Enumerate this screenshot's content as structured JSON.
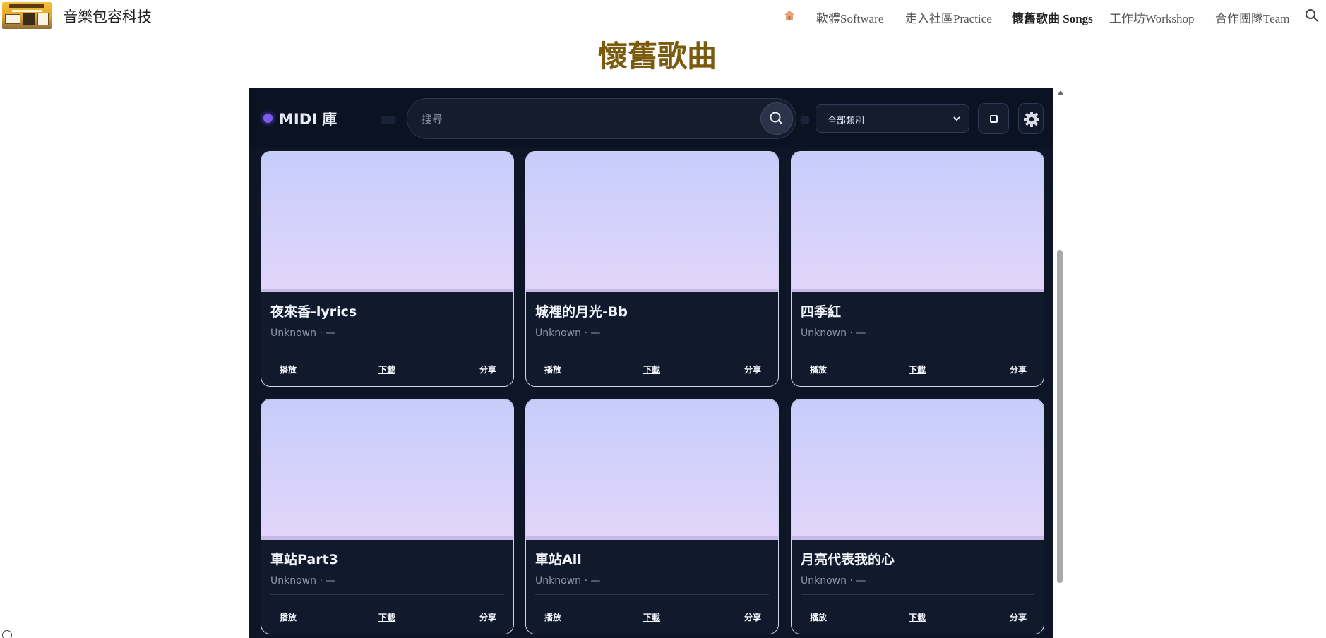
{
  "site": {
    "title": "音樂包容科技",
    "nav": [
      "軟體Software",
      "走入社區Practice",
      "懷舊歌曲 Songs",
      "工作坊Workshop",
      "合作團隊Team"
    ],
    "active_nav": "懷舊歌曲 Songs"
  },
  "page": {
    "title": "懷舊歌曲"
  },
  "app": {
    "brand": "MIDI 庫",
    "search": {
      "placeholder": "搜尋",
      "value": ""
    },
    "category_select": {
      "selected": "全部類別"
    },
    "accent_color": "#7c5cf0"
  },
  "songs": [
    {
      "title": "夜來香-lyrics",
      "meta": "Unknown · —",
      "play": "播放",
      "download": "下載",
      "share": "分享"
    },
    {
      "title": "城裡的月光-Bb",
      "meta": "Unknown · —",
      "play": "播放",
      "download": "下載",
      "share": "分享"
    },
    {
      "title": "四季紅",
      "meta": "Unknown · —",
      "play": "播放",
      "download": "下載",
      "share": "分享"
    },
    {
      "title": "車站Part3",
      "meta": "Unknown · —",
      "play": "播放",
      "download": "下載",
      "share": "分享"
    },
    {
      "title": "車站All",
      "meta": "Unknown · —",
      "play": "播放",
      "download": "下載",
      "share": "分享"
    },
    {
      "title": "月亮代表我的心",
      "meta": "Unknown · —",
      "play": "播放",
      "download": "下載",
      "share": "分享"
    }
  ],
  "icons": [
    "home-icon",
    "search-icon",
    "gear-icon",
    "chevron-down-icon",
    "info-icon"
  ]
}
